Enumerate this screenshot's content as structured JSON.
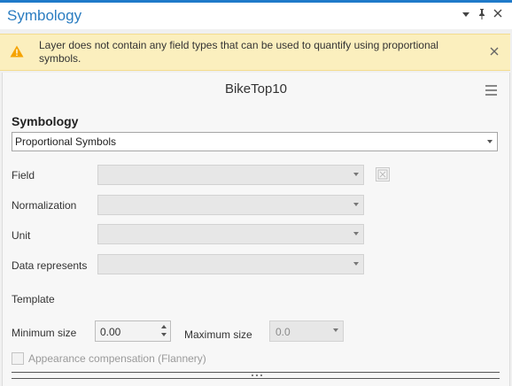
{
  "panel": {
    "title": "Symbology",
    "controls": [
      "chevron-down-icon",
      "pin-icon",
      "close-icon"
    ]
  },
  "warning": {
    "text": "Layer does not contain any field types that can be used to quantify using proportional symbols.",
    "icon": "warning-icon",
    "color": "#fbefbe"
  },
  "layer": {
    "name": "BikeTop10"
  },
  "symbology": {
    "label": "Symbology",
    "selected": "Proportional Symbols"
  },
  "fields": {
    "field_label": "Field",
    "normalization_label": "Normalization",
    "unit_label": "Unit",
    "data_represents_label": "Data represents"
  },
  "template": {
    "label": "Template",
    "min_label": "Minimum size",
    "min_value": "0.00",
    "max_label": "Maximum size",
    "max_value": "0.0"
  },
  "appearance": {
    "label": "Appearance compensation (Flannery)",
    "checked": false
  },
  "colors": {
    "accent": "#1f7ac9",
    "title": "#2b7dc1"
  }
}
